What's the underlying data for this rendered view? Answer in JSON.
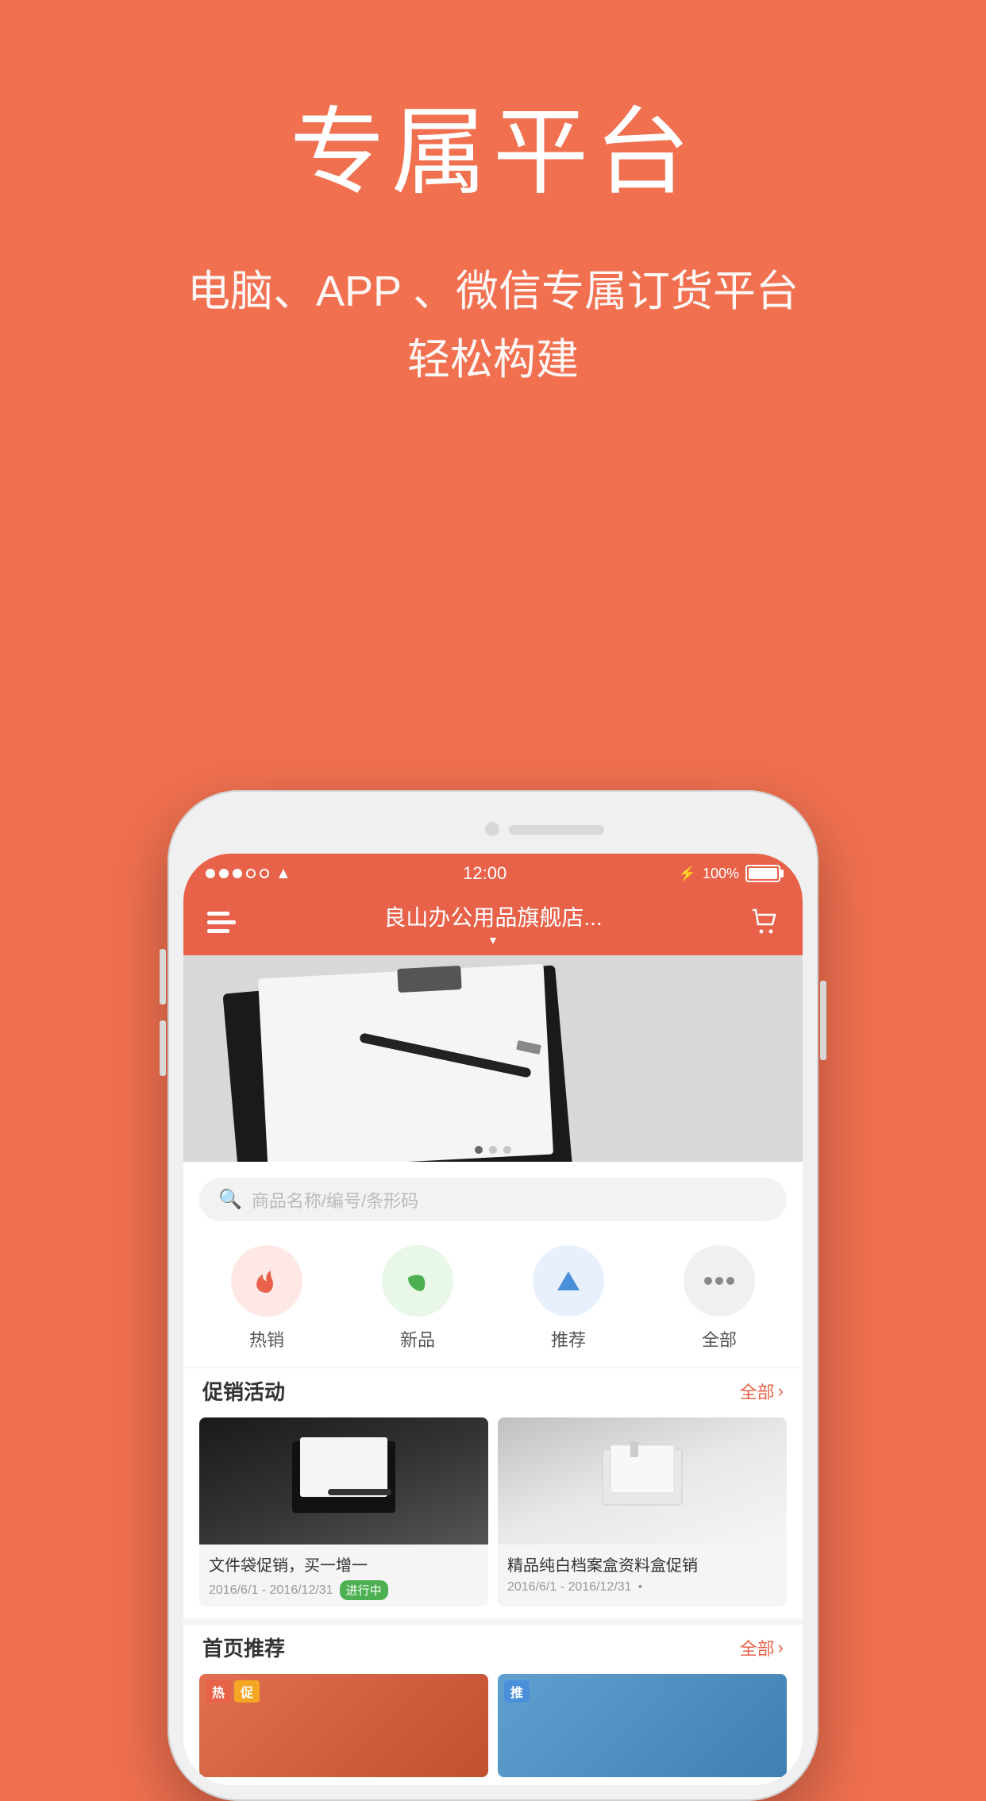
{
  "page": {
    "background_color": "#F07050"
  },
  "header": {
    "main_title": "专属平台",
    "sub_title_line1": "电脑、APP 、微信专属订货平台",
    "sub_title_line2": "轻松构建"
  },
  "status_bar": {
    "time": "12:00",
    "battery": "100%",
    "signal_dots": [
      "filled",
      "filled",
      "filled",
      "empty",
      "empty"
    ],
    "wifi": "WiFi"
  },
  "navbar": {
    "title": "良山办公用品旗舰店...",
    "dropdown_arrow": "▾",
    "left_icon": "menu",
    "right_icon": "cart"
  },
  "search": {
    "placeholder": "商品名称/编号/条形码"
  },
  "categories": [
    {
      "id": "hot",
      "label": "热销",
      "icon": "🔥",
      "style": "cat-hot"
    },
    {
      "id": "new",
      "label": "新品",
      "icon": "🌿",
      "style": "cat-new"
    },
    {
      "id": "rec",
      "label": "推荐",
      "icon": "▲",
      "style": "cat-rec"
    },
    {
      "id": "all",
      "label": "全部",
      "icon": "···",
      "style": "cat-all"
    }
  ],
  "promotions": {
    "section_title": "促销活动",
    "all_label": "全部",
    "chevron": "›",
    "items": [
      {
        "name": "文件袋促销，买一增一",
        "date": "2016/6/1 - 2016/12/31",
        "status": "进行中",
        "status_color": "#4CAF50"
      },
      {
        "name": "精品纯白档案盒资料盒促销",
        "date": "2016/6/1 - 2016/12/31",
        "status": "•",
        "status_color": "#999"
      }
    ]
  },
  "home_rec": {
    "section_title": "首页推荐",
    "all_label": "全部",
    "chevron": "›",
    "products": [
      {
        "tags": [
          "热",
          "促"
        ],
        "tag_colors": [
          "tag-hot",
          "tag-promo"
        ]
      },
      {
        "tags": [
          "推"
        ],
        "tag_colors": [
          "tag-rec"
        ]
      }
    ]
  },
  "icons": {
    "search": "🔍",
    "menu": "☰",
    "cart": "🛒",
    "fire": "🔥",
    "leaf": "🌿",
    "triangle": "▲",
    "dots": "···"
  }
}
